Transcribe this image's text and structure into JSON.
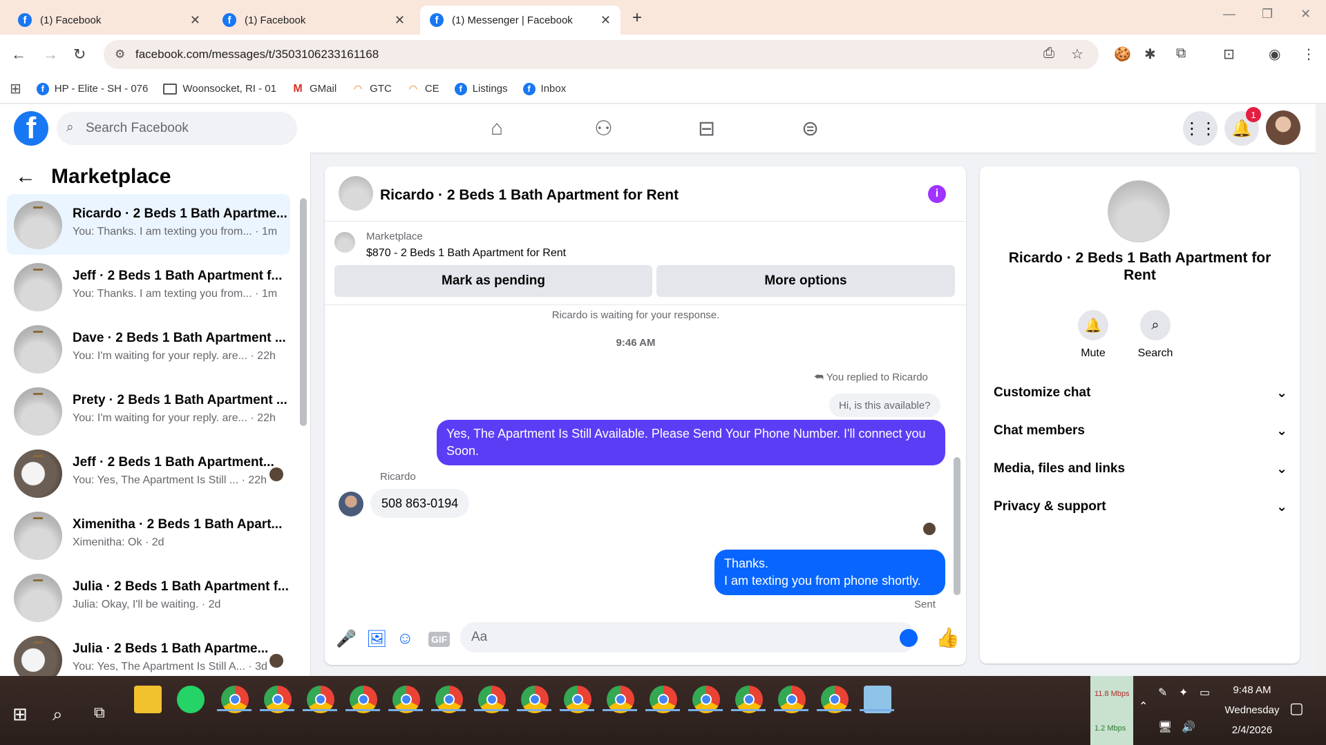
{
  "browser": {
    "tabs": [
      {
        "label": "(1) Facebook"
      },
      {
        "label": "(1) Facebook"
      },
      {
        "label": "(1) Messenger | Facebook"
      }
    ],
    "url": "facebook.com/messages/t/3503106233161168",
    "bookmarks": [
      {
        "label": "HP - Elite - SH - 076",
        "icon": "facebook-icon"
      },
      {
        "label": "Woonsocket, RI - 01",
        "icon": "folder-icon"
      },
      {
        "label": "GMail",
        "icon": "gmail-icon"
      },
      {
        "label": "GTC",
        "icon": "rainbow-icon"
      },
      {
        "label": "CE",
        "icon": "rainbow-icon"
      },
      {
        "label": "Listings",
        "icon": "facebook-icon"
      },
      {
        "label": "Inbox",
        "icon": "facebook-icon"
      }
    ]
  },
  "fb": {
    "search_placeholder": "Search Facebook",
    "notifications": "1"
  },
  "sidebar": {
    "title": "Marketplace",
    "conversations": [
      {
        "name": "Ricardo · 2 Beds 1 Bath Apartme...",
        "snippet": "You: Thanks. I am texting you from... · 1m"
      },
      {
        "name": "Jeff · 2 Beds 1 Bath Apartment f...",
        "snippet": "You: Thanks. I am texting you from... · 1m"
      },
      {
        "name": "Dave · 2 Beds 1 Bath Apartment ...",
        "snippet": "You: I'm waiting for your reply. are... · 22h"
      },
      {
        "name": "Prety · 2 Beds 1 Bath Apartment ...",
        "snippet": "You: I'm waiting for your reply. are... · 22h"
      },
      {
        "name": "Jeff · 2 Beds 1 Bath Apartment...",
        "snippet": "You: Yes, The Apartment Is Still ... · 22h"
      },
      {
        "name": "Ximenitha · 2 Beds 1 Bath Apart...",
        "snippet": "Ximenitha: Ok · 2d"
      },
      {
        "name": "Julia · 2 Beds 1 Bath Apartment f...",
        "snippet": "Julia: Okay, I'll be waiting. · 2d"
      },
      {
        "name": "Julia · 2 Beds 1 Bath Apartme...",
        "snippet": "You: Yes, The Apartment Is Still A... · 3d"
      }
    ]
  },
  "chat": {
    "title": "Ricardo · 2 Beds 1 Bath Apartment for Rent",
    "listing_label": "Marketplace",
    "listing_price": "$870 - 2 Beds 1 Bath Apartment for Rent",
    "mark_pending": "Mark as pending",
    "more_options": "More options",
    "waiting": "Ricardo is waiting for your response.",
    "time": "9:46 AM",
    "replied_to": "You replied to Ricardo",
    "quoted": "Hi, is this available?",
    "out_msg_1": "Yes, The Apartment Is Still Available. Please Send Your Phone Number. I'll connect you Soon.",
    "sender": "Ricardo",
    "in_msg": "508 863-0194",
    "out_msg_2_line1": "Thanks.",
    "out_msg_2_line2": "I am texting you from phone shortly.",
    "sent": "Sent",
    "composer_placeholder": "Aa"
  },
  "info": {
    "title": "Ricardo · 2 Beds 1 Bath Apartment for Rent",
    "mute": "Mute",
    "search": "Search",
    "rows": [
      "Customize chat",
      "Chat members",
      "Media, files and links",
      "Privacy & support"
    ]
  },
  "taskbar": {
    "net_down": "11.8 Mbps",
    "net_up": "1.2 Mbps",
    "time": "9:48 AM",
    "day": "Wednesday",
    "date": "2/4/2026"
  }
}
